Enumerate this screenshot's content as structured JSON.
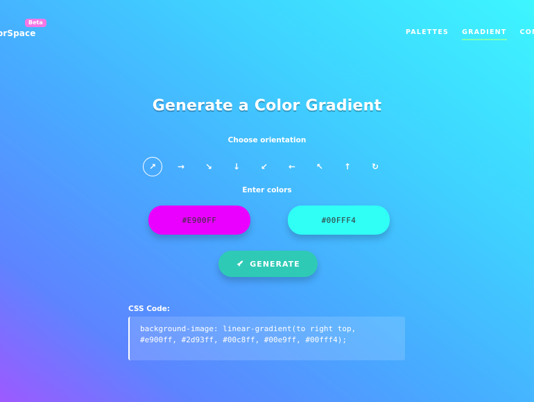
{
  "header": {
    "logo": "orSpace",
    "badge": "Beta",
    "nav": [
      "PALETTES",
      "GRADIENT",
      "CONTA"
    ],
    "active_nav": "GRADIENT"
  },
  "main": {
    "title": "Generate a Color Gradient",
    "orientation_label": "Choose orientation",
    "orientations": [
      {
        "icon": "arrow-up-right-icon",
        "glyph": "↗",
        "selected": true
      },
      {
        "icon": "arrow-right-icon",
        "glyph": "→"
      },
      {
        "icon": "arrow-down-right-icon",
        "glyph": "↘"
      },
      {
        "icon": "arrow-down-icon",
        "glyph": "↓"
      },
      {
        "icon": "arrow-down-left-icon",
        "glyph": "↙"
      },
      {
        "icon": "arrow-left-icon",
        "glyph": "←"
      },
      {
        "icon": "arrow-up-left-icon",
        "glyph": "↖"
      },
      {
        "icon": "arrow-up-icon",
        "glyph": "↑"
      },
      {
        "icon": "radial-icon",
        "glyph": "↻"
      }
    ],
    "colors_label": "Enter colors",
    "color1": {
      "value": "#E900FF",
      "bg": "#e900ff"
    },
    "color2": {
      "value": "#00FFF4",
      "bg": "#30fff6"
    },
    "generate_label": "GENERATE",
    "generate_icon": "rocket-icon"
  },
  "code": {
    "label": "CSS Code:",
    "line1": "background-image: linear-gradient(to right top,",
    "line2": "#e900ff, #2d93ff, #00c8ff, #00e9ff, #00fff4);"
  }
}
